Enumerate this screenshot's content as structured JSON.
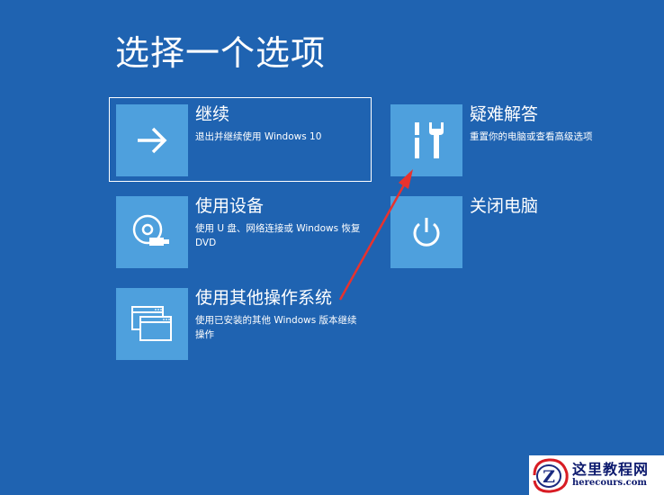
{
  "page": {
    "title": "选择一个选项"
  },
  "options": {
    "continue": {
      "label": "继续",
      "desc": "退出并继续使用 Windows 10",
      "icon": "arrow-right-icon"
    },
    "use_device": {
      "label": "使用设备",
      "desc": "使用 U 盘、网络连接或 Windows 恢复 DVD",
      "icon": "disc-usb-icon"
    },
    "other_os": {
      "label": "使用其他操作系统",
      "desc": "使用已安装的其他 Windows 版本继续操作",
      "icon": "windows-stack-icon"
    },
    "troubleshoot": {
      "label": "疑难解答",
      "desc": "重置你的电脑或查看高级选项",
      "icon": "tools-icon"
    },
    "shutdown": {
      "label": "关闭电脑",
      "icon": "power-icon"
    }
  },
  "annotation": {
    "color": "#e8322e"
  },
  "watermark": {
    "title": "这里教程网",
    "url": "herecours.com"
  },
  "colors": {
    "background": "#1f63b1",
    "tile": "#4ea0dd"
  }
}
